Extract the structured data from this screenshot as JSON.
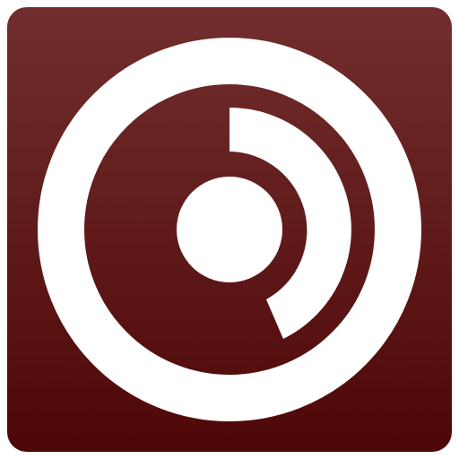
{
  "app_icon": {
    "icon": "circular-gauge-icon",
    "colors": {
      "background_top": "#722e2e",
      "background_bottom": "#4e0707",
      "glyph": "#ffffff"
    }
  }
}
